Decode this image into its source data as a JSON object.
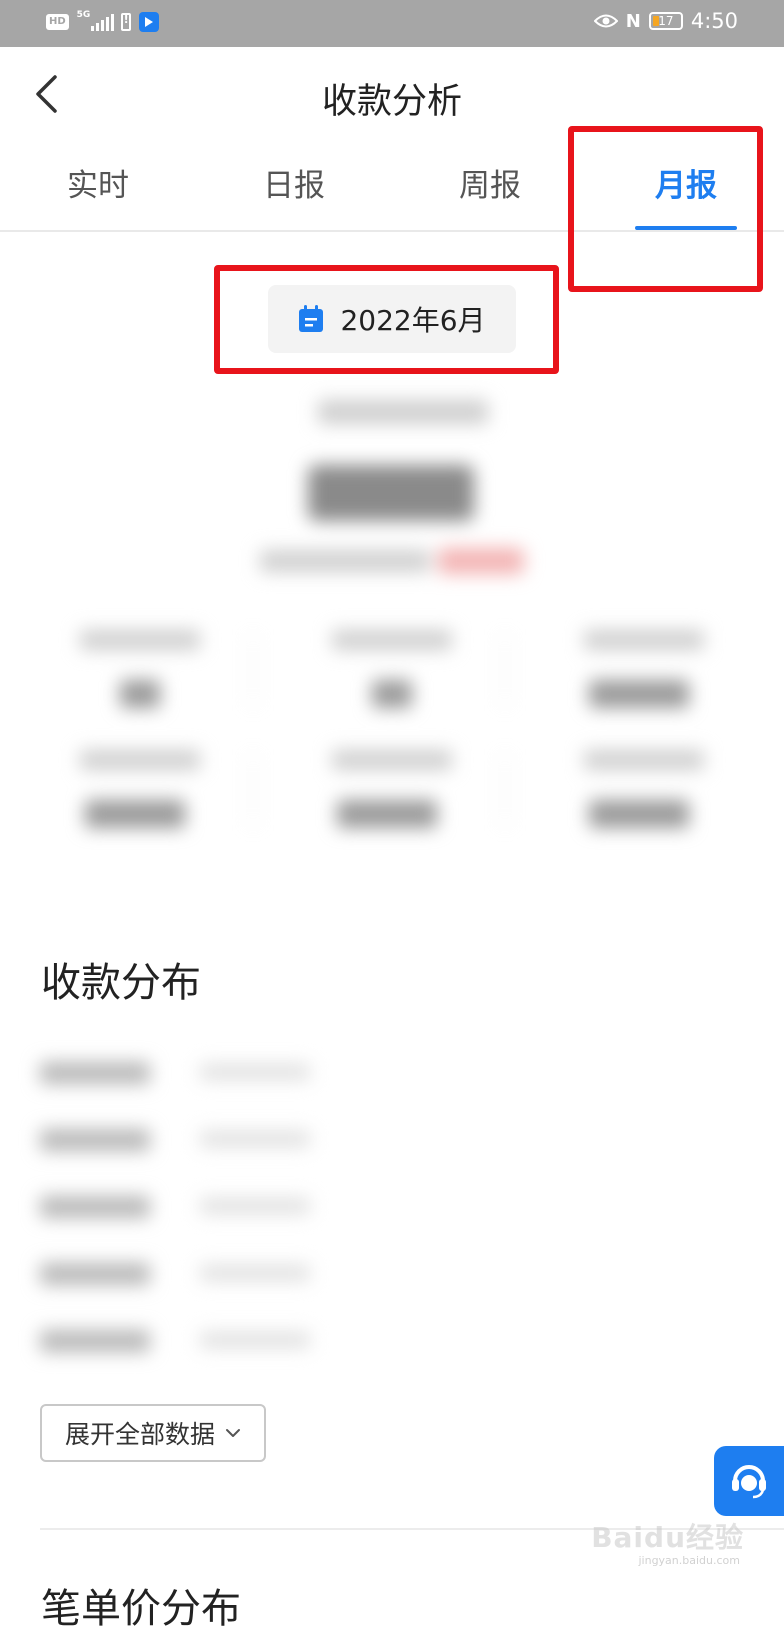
{
  "status_bar": {
    "hd": "HD",
    "network": "5G",
    "battery_level": "17",
    "time": "4:50",
    "icons": [
      "hd-icon",
      "signal-icon",
      "battery-alert-icon",
      "app-notification-icon",
      "eye-icon",
      "nfc-icon",
      "battery-icon"
    ]
  },
  "header": {
    "title": "收款分析",
    "back_icon": "chevron-left-icon"
  },
  "tabs": [
    {
      "label": "实时",
      "active": false
    },
    {
      "label": "日报",
      "active": false
    },
    {
      "label": "周报",
      "active": false
    },
    {
      "label": "月报",
      "active": true
    }
  ],
  "date_picker": {
    "icon": "calendar-icon",
    "value": "2022年6月"
  },
  "sections": {
    "distribution_title": "收款分布",
    "expand_label": "展开全部数据",
    "expand_icon": "chevron-down-icon",
    "next_title": "笔单价分布"
  },
  "support": {
    "icon": "customer-service-icon"
  },
  "watermark": {
    "text": "Baidu经验",
    "sub": "jingyan.baidu.com"
  },
  "colors": {
    "accent": "#1e7ef0",
    "status_bar": "#a6a6a6",
    "highlight_box": "#e8141b"
  }
}
